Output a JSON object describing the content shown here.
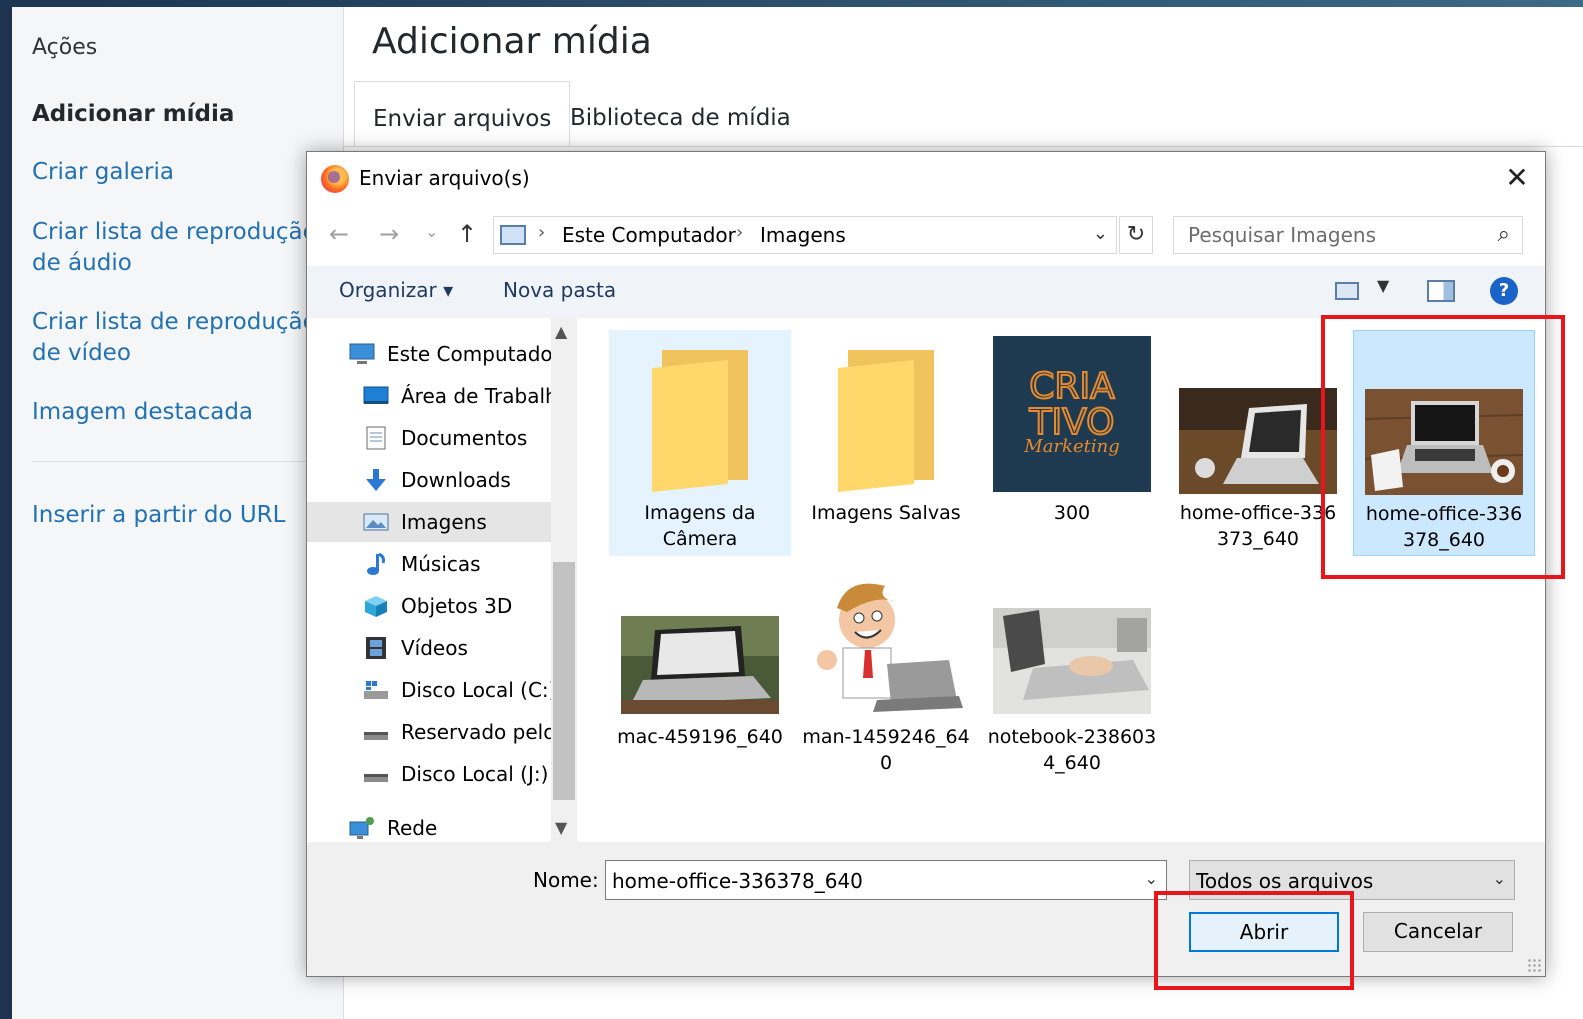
{
  "sidebar": {
    "heading": "Ações",
    "current": "Adicionar mídia",
    "links": [
      "Criar galeria",
      "Criar lista de reprodução de áudio",
      "Criar lista de reprodução de vídeo",
      "Imagem destacada",
      "Inserir a partir do URL"
    ]
  },
  "main": {
    "title": "Adicionar mídia",
    "tabs": [
      "Enviar arquivos",
      "Biblioteca de mídia"
    ]
  },
  "dialog": {
    "title": "Enviar arquivo(s)",
    "close_glyph": "✕",
    "nav": {
      "back": "←",
      "forward": "→",
      "recent": "⌄",
      "up": "↑",
      "refresh": "↻"
    },
    "breadcrumb": [
      "Este Computador",
      "Imagens"
    ],
    "search_placeholder": "Pesquisar Imagens",
    "toolbar": {
      "organize": "Organizar ▾",
      "new_folder": "Nova pasta",
      "help": "?"
    },
    "tree": [
      {
        "label": "Este Computador",
        "icon": "computer-icon",
        "level": 0
      },
      {
        "label": "Área de Trabalho",
        "icon": "desktop-icon",
        "level": 1
      },
      {
        "label": "Documentos",
        "icon": "documents-icon",
        "level": 1
      },
      {
        "label": "Downloads",
        "icon": "downloads-icon",
        "level": 1
      },
      {
        "label": "Imagens",
        "icon": "pictures-icon",
        "level": 1,
        "selected": true
      },
      {
        "label": "Músicas",
        "icon": "music-icon",
        "level": 1
      },
      {
        "label": "Objetos 3D",
        "icon": "objects-3d-icon",
        "level": 1
      },
      {
        "label": "Vídeos",
        "icon": "videos-icon",
        "level": 1
      },
      {
        "label": "Disco Local (C:)",
        "icon": "drive-c-icon",
        "level": 1
      },
      {
        "label": "Reservado pelo Sistema",
        "icon": "drive-reserved-icon",
        "level": 1
      },
      {
        "label": "Disco Local (J:)",
        "icon": "drive-j-icon",
        "level": 1
      },
      {
        "label": "Rede",
        "icon": "network-icon",
        "level": 0
      }
    ],
    "files": [
      {
        "caption": [
          "Imagens da",
          "Câmera"
        ],
        "kind": "folder",
        "state": "hover"
      },
      {
        "caption": [
          "Imagens Salvas"
        ],
        "kind": "folder"
      },
      {
        "caption": [
          "300"
        ],
        "kind": "logo",
        "logo_text": [
          "CRIA",
          "TIVO",
          "Marketing"
        ]
      },
      {
        "caption": [
          "home-office-336",
          "373_640"
        ],
        "kind": "photo-laptop-desk"
      },
      {
        "caption": [
          "home-office-336",
          "378_640"
        ],
        "kind": "photo-laptop-wood",
        "state": "selected"
      },
      {
        "caption": [
          "mac-459196_640"
        ],
        "kind": "photo-mac"
      },
      {
        "caption": [
          "man-1459246_64",
          "0"
        ],
        "kind": "cartoon-man"
      },
      {
        "caption": [
          "notebook-238603",
          "4_640"
        ],
        "kind": "photo-notebook"
      }
    ],
    "name_label": "Nome:",
    "name_value": "home-office-336378_640",
    "filter_value": "Todos os arquivos",
    "open_label": "Abrir",
    "cancel_label": "Cancelar"
  },
  "colors": {
    "link": "#2271b1",
    "highlight": "#e8161b",
    "selection": "#cce8ff"
  }
}
